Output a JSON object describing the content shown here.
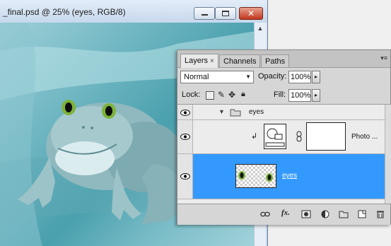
{
  "document": {
    "title": "_final.psd @ 25% (eyes, RGB/8)",
    "close_glyph": "✕"
  },
  "layers_panel": {
    "tabs": [
      {
        "label": "Layers",
        "close": "×"
      },
      {
        "label": "Channels"
      },
      {
        "label": "Paths"
      }
    ],
    "blend_mode": "Normal",
    "opacity_label": "Opacity:",
    "opacity_value": "100%",
    "lock_label": "Lock:",
    "fill_label": "Fill:",
    "fill_value": "100%",
    "layers": [
      {
        "name": "eyes",
        "type": "group"
      },
      {
        "name": "Photo ...",
        "type": "adjustment-clipped"
      },
      {
        "name": "eyes",
        "type": "pixel",
        "selected": true
      }
    ]
  },
  "colors": {
    "selection": "#3399ff",
    "close_button": "#c2361d"
  },
  "icons": [
    "eye-icon",
    "folder-icon",
    "lock-icon",
    "brush-icon",
    "move-icon",
    "link-icon",
    "fx-icon",
    "mask-icon",
    "adjustment-icon",
    "new-group-icon",
    "new-layer-icon",
    "trash-icon",
    "clip-arrow-icon",
    "chain-link-icon"
  ]
}
